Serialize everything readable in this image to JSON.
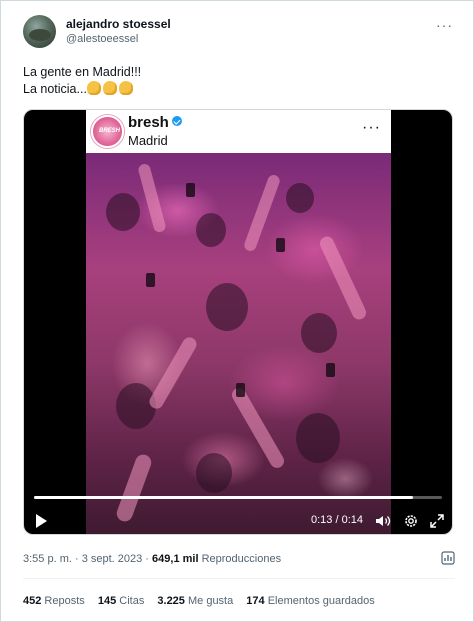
{
  "author": {
    "name": "alejandro stoessel",
    "handle": "@alestoeessel",
    "avatar_icon": "profile-photo"
  },
  "tweet": {
    "line1": "La gente en Madrid!!!",
    "line2": "La noticia...",
    "emoji_icon": "ok-hand-emoji",
    "emoji_count": 3
  },
  "embedded_post": {
    "account": "bresh",
    "location": "Madrid",
    "verified": true
  },
  "video": {
    "current_time": "0:13",
    "duration": "0:14",
    "time_display": "0:13 / 0:14",
    "progress": 0.93
  },
  "meta": {
    "timestamp": "3:55 p. m. · 3 sept. 2023",
    "separator": " · ",
    "views_count": "649,1 mil",
    "views_label": "Reproducciones"
  },
  "stats": [
    {
      "count": "452",
      "label": "Reposts"
    },
    {
      "count": "145",
      "label": "Citas"
    },
    {
      "count": "3.225",
      "label": "Me gusta"
    },
    {
      "count": "174",
      "label": "Elementos guardados"
    }
  ],
  "colors": {
    "text": "#0f1419",
    "secondary": "#536471",
    "verified": "#1d9bf0",
    "border": "#cfd9de"
  }
}
